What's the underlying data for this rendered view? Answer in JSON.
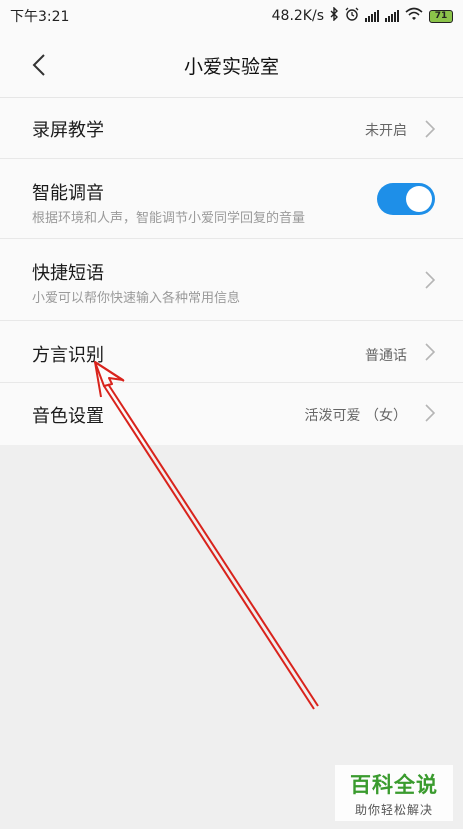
{
  "status_bar": {
    "time": "下午3:21",
    "network_speed": "48.2K/s",
    "battery": "71",
    "icons": [
      "bluetooth-icon",
      "alarm-icon",
      "signal-icon",
      "signal-icon",
      "wifi-icon",
      "battery-icon"
    ]
  },
  "header": {
    "title": "小爱实验室",
    "back_icon": "chevron-left-icon"
  },
  "settings": [
    {
      "title": "录屏教学",
      "value": "未开启"
    },
    {
      "title": "智能调音",
      "subtitle": "根据环境和人声，智能调节小爱同学回复的音量",
      "toggle": "on"
    },
    {
      "title": "快捷短语",
      "subtitle": "小爱可以帮你快速输入各种常用信息"
    },
    {
      "title": "方言识别",
      "value": "普通话"
    },
    {
      "title": "音色设置",
      "value": "活泼可爱 （女）"
    }
  ],
  "annotation": {
    "arrow_color": "#d9231c"
  },
  "watermark": {
    "title": "百科全说",
    "subtitle": "助你轻松解决",
    "color": "#3a9b2e"
  }
}
